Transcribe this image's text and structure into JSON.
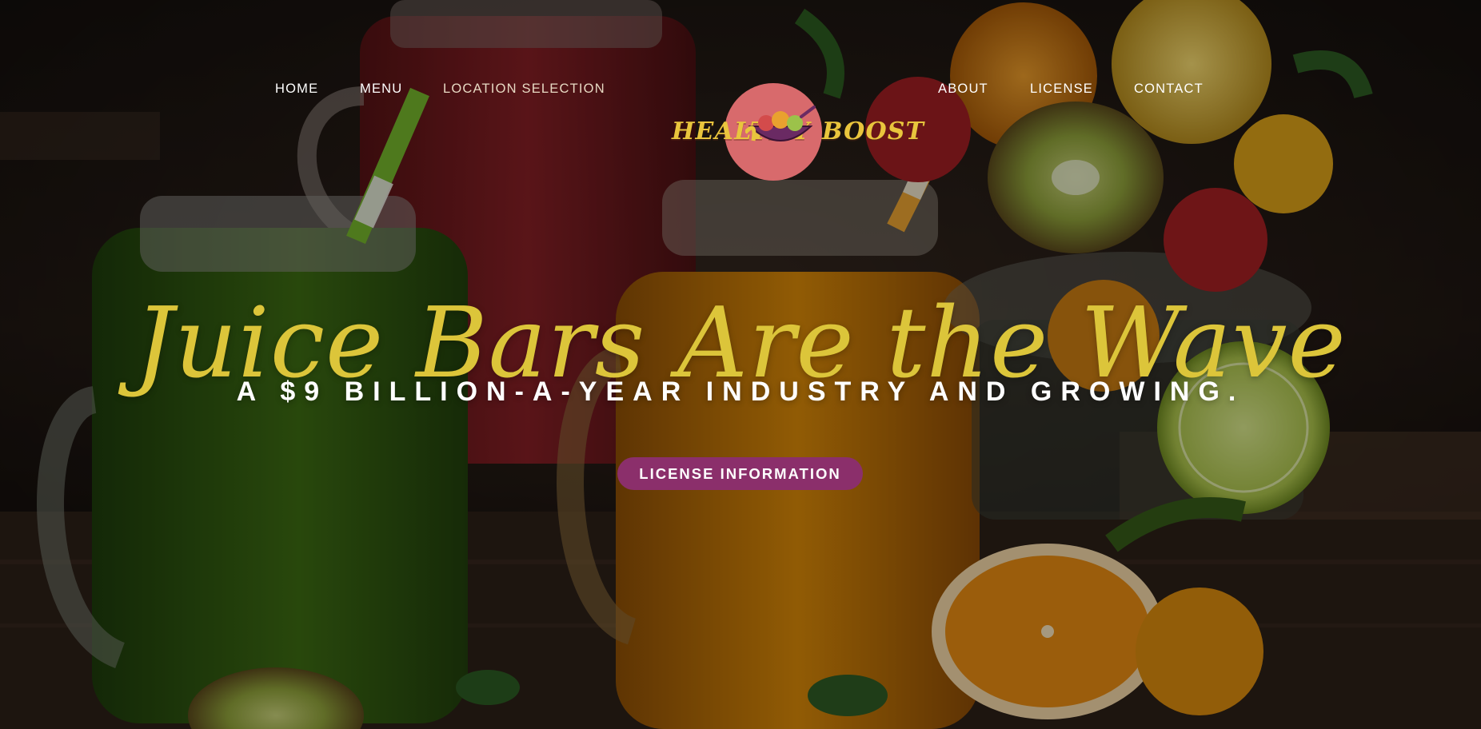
{
  "nav": {
    "items_left": [
      {
        "label": "HOME"
      },
      {
        "label": "MENU"
      },
      {
        "label": "LOCATION SELECTION"
      }
    ],
    "items_right": [
      {
        "label": "ABOUT"
      },
      {
        "label": "LICENSE"
      },
      {
        "label": "CONTACT"
      }
    ]
  },
  "logo": {
    "text_left": "Healthy",
    "text_right": "Boost"
  },
  "hero": {
    "headline": "Juice Bars Are the Wave",
    "subhead": "A $9 BILLION-A-YEAR INDUSTRY AND GROWING.",
    "cta_label": "LICENSE INFORMATION"
  },
  "colors": {
    "headline": "#dcc53a",
    "cta_background": "#8b2f6b",
    "logo_disc": "#d86a6c",
    "logo_text": "#e9c53d",
    "nav_text": "#ffffff"
  },
  "background": {
    "icon": "juice-jars-and-fruit-photo"
  }
}
